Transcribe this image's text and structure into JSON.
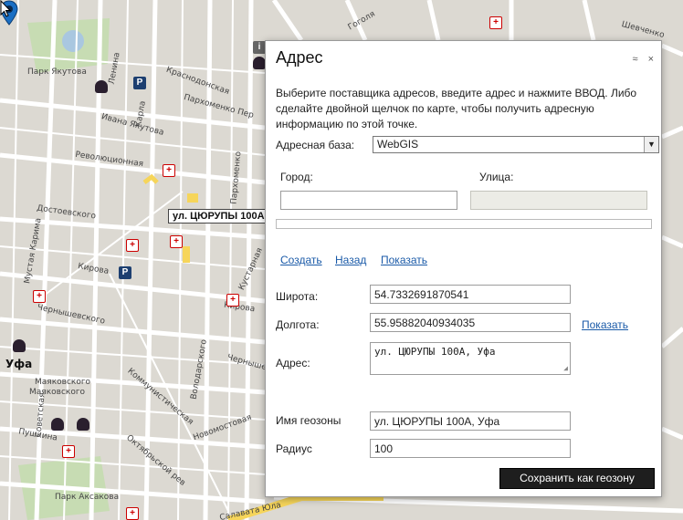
{
  "map": {
    "labels": {
      "park_yakutova": "Парк Якутова",
      "ufa": "Уфа",
      "mayakovsky1": "Маяковского",
      "mayakovsky2": "Маяковского",
      "pushkina": "Пушкина",
      "park_aksakova": "Парк Аксакова",
      "krasnodonskaya": "Краснодонская",
      "parkhomenko": "Пархоменко Пер",
      "ivana_yakutova": "Ивана Якутова",
      "revolyutsionnaya": "Революционная",
      "dostoevskogo": "Достоевского",
      "kirova1": "Кирова",
      "kirova2": "Кирова",
      "chernyshevskogo": "Чернышевского",
      "chernyshevs2": "Чернышевс",
      "novomostovaya": "Новомостовая",
      "kommunisticheskaya": "Коммунистическая",
      "oktyabrskoy": "Октябрьской рев",
      "salavata": "Салавата Юла",
      "mustaya": "Мустая Карима",
      "sovetskaya": "Советская",
      "lenina": "Ленина",
      "karla": "Карла",
      "parkhomenko2": "Пархоменко",
      "kustarnaya": "Кустарная",
      "volodarskogo": "Володарского",
      "shevchenko": "Шевченко",
      "gogolya": "Гоголя"
    },
    "marker_tooltip": "ул. ЦЮРУПЫ 100А, Уфа"
  },
  "dialog": {
    "title": "Адрес",
    "collapse_icon": "≈",
    "close_icon": "×",
    "description": "Выберите поставщика адресов, введите адрес и нажмите ВВОД. Либо сделайте двойной щелчок по карте, чтобы получить адресную информацию по этой точке.",
    "address_base_label": "Адресная база:",
    "address_base_value": "WebGIS",
    "city_label": "Город:",
    "street_label": "Улица:",
    "city_value": "",
    "street_value": "",
    "links": {
      "create": "Создать",
      "back": "Назад",
      "show": "Показать"
    },
    "latitude_label": "Широта:",
    "latitude_value": "54.7332691870541",
    "longitude_label": "Долгота:",
    "longitude_value": "55.95882040934035",
    "show_link": "Показать",
    "address_label": "Адрес:",
    "address_value": "ул. ЦЮРУПЫ 100А, Уфа",
    "geozone_label": "Имя геозоны",
    "geozone_value": "ул. ЦЮРУПЫ 100А, Уфа",
    "radius_label": "Радиус",
    "radius_value": "100",
    "save_button": "Сохранить как геозону"
  },
  "colors": {
    "road_major": "#ffffff",
    "road_highlight": "#f6d55a",
    "park": "#c7dcb3",
    "block": "#dcd9d2",
    "link": "#1a5aa8",
    "marker": "#1a6fc4"
  }
}
